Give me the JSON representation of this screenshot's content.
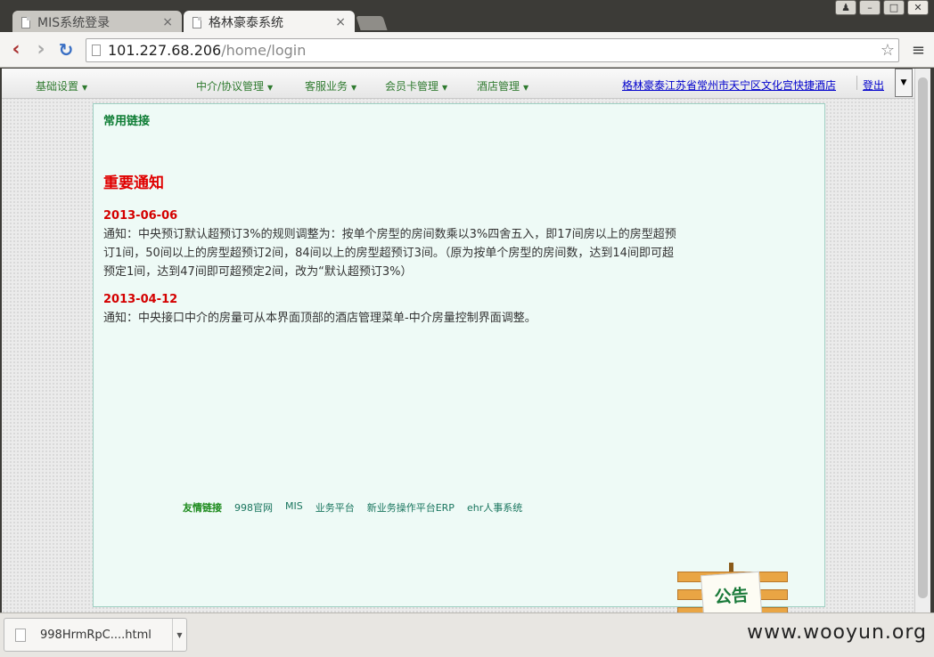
{
  "browser": {
    "tabs": [
      {
        "title": "MIS系统登录",
        "active": false
      },
      {
        "title": "格林豪泰系统",
        "active": true
      }
    ],
    "url_host": "101.227.68.206",
    "url_path": "/home/login"
  },
  "menubar": {
    "items": [
      "基础设置",
      "中介/协议管理",
      "客服业务",
      "会员卡管理",
      "酒店管理"
    ],
    "hotel_name": "格林豪泰江苏省常州市天宁区文化宫快捷酒店",
    "logout": "登出"
  },
  "content": {
    "quick_links": "常用链接",
    "notice_title": "重要通知",
    "notices": [
      {
        "date": "2013-06-06",
        "text": "通知：中央预订默认超预订3%的规则调整为：按单个房型的房间数乘以3%四舍五入，即17间房以上的房型超预订1间，50间以上的房型超预订2间，84间以上的房型超预订3间。（原为按单个房型的房间数，达到14间即可超预定1间，达到47间即可超预定2间，改为“默认超预订3%）"
      },
      {
        "date": "2013-04-12",
        "text": "通知：中央接口中介的房量可从本界面顶部的酒店管理菜单-中介房量控制界面调整。"
      }
    ],
    "friend_links_label": "友情链接",
    "friend_links": [
      "998官网",
      "MIS",
      "业务平台",
      "新业务操作平台ERP",
      "ehr人事系统"
    ],
    "board_text": "公告"
  },
  "download": {
    "filename": "998HrmRpC....html"
  },
  "watermark": "www.wooyun.org"
}
